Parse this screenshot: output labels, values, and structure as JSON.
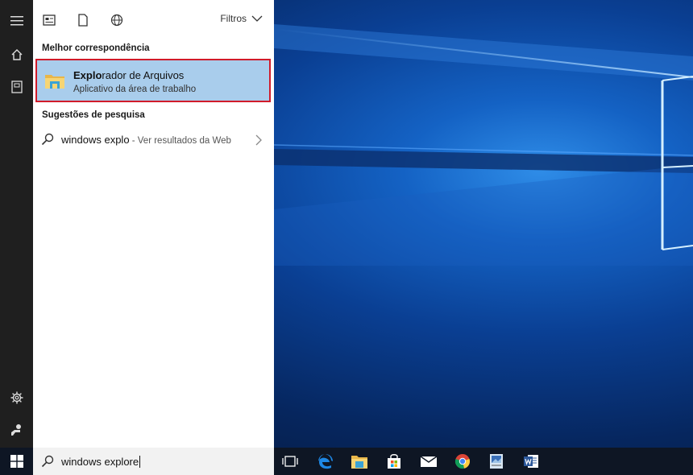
{
  "panel": {
    "filters_label": "Filtros",
    "best_match_heading": "Melhor correspondência",
    "best_match": {
      "title_bold": "Explo",
      "title_rest": "rador de Arquivos",
      "subtitle": "Aplicativo da área de trabalho"
    },
    "suggestions_heading": "Sugestões de pesquisa",
    "suggestion": {
      "query": "windows explo",
      "hint": " - Ver resultados da Web"
    }
  },
  "search": {
    "value": "windows explore"
  },
  "icons": {
    "rail": [
      "hamburger-icon",
      "home-icon",
      "notebook-icon",
      "settings-icon",
      "feedback-icon"
    ],
    "panel_top": [
      "apps-filter-icon",
      "documents-filter-icon",
      "web-filter-icon"
    ],
    "taskbar": [
      "windows-start-icon",
      "task-view-icon",
      "edge-icon",
      "file-explorer-icon",
      "store-icon",
      "mail-icon",
      "chrome-icon",
      "app-icon",
      "word-icon"
    ]
  },
  "colors": {
    "selection": "#a9cdec",
    "highlight_border": "#d11b2a",
    "rail_bg": "#1f1f1f",
    "taskbar_bg": "#0e1624"
  }
}
